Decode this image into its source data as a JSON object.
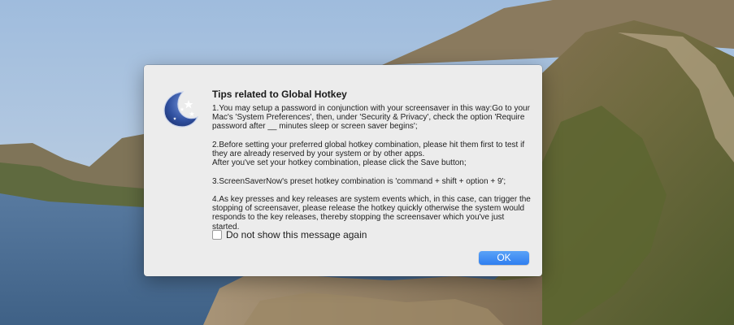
{
  "dialog": {
    "title": "Tips related to Global Hotkey",
    "tips": [
      "1.You may setup a password in conjunction with your screensaver in this way:Go to your Mac's 'System Preferences', then, under 'Security & Privacy', check the option 'Require password after __ minutes sleep or screen saver begins';",
      "2.Before setting your preferred global hotkey combination, please hit them first to test if they are already reserved by your system or by other apps. After you've set your hotkey combination, please click the Save button;",
      "3.ScreenSaverNow's preset hotkey combination is 'command + shift + option + 9';",
      "4.As key presses and key releases are system events which, in this case, can trigger the stopping of screensaver, please release the hotkey quickly otherwise the system would responds to the key releases, thereby stopping the screensaver which you've just started."
    ],
    "tip2_line2": "After you've set your hotkey combination, please click the Save button;",
    "checkbox_label": "Do not show this message again",
    "checkbox_checked": false,
    "ok_label": "OK",
    "icon": "crescent-moon-stars-icon"
  },
  "colors": {
    "ok_button": "#2f7ff0",
    "dialog_bg": "#ececec"
  }
}
